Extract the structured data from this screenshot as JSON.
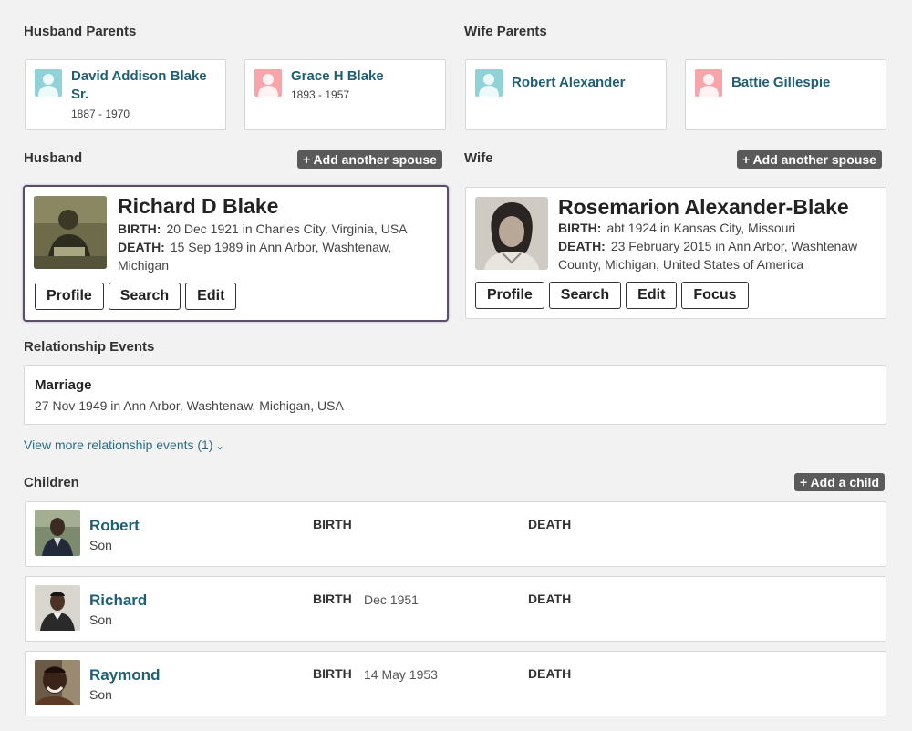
{
  "husband_parents": {
    "label": "Husband Parents",
    "father": {
      "name": "David Addison Blake Sr.",
      "dates": "1887 - 1970"
    },
    "mother": {
      "name": "Grace H Blake",
      "dates": "1893 - 1957"
    }
  },
  "wife_parents": {
    "label": "Wife Parents",
    "father": {
      "name": "Robert Alexander"
    },
    "mother": {
      "name": "Battie Gillespie"
    }
  },
  "husband": {
    "label": "Husband",
    "add_spouse": "+ Add another spouse",
    "name": "Richard D Blake",
    "birth_label": "BIRTH:",
    "birth": "20 Dec 1921 in Charles City, Virginia, USA",
    "death_label": "DEATH:",
    "death": "15 Sep 1989 in Ann Arbor, Washtenaw,",
    "death_cont": "Michigan",
    "buttons": {
      "profile": "Profile",
      "search": "Search",
      "edit": "Edit"
    }
  },
  "wife": {
    "label": "Wife",
    "add_spouse": "+ Add another spouse",
    "name": "Rosemarion Alexander-Blake",
    "birth_label": "BIRTH:",
    "birth": "abt 1924 in Kansas City, Missouri",
    "death_label": "DEATH:",
    "death": "23 February 2015 in Ann Arbor, Washtenaw",
    "death_cont": "County, Michigan, United States of America",
    "buttons": {
      "profile": "Profile",
      "search": "Search",
      "edit": "Edit",
      "focus": "Focus"
    }
  },
  "relationship": {
    "label": "Relationship Events",
    "event_title": "Marriage",
    "event_detail": "27 Nov 1949 in Ann Arbor, Washtenaw, Michigan, USA",
    "view_more": "View more relationship events (1)"
  },
  "children": {
    "label": "Children",
    "add_child": "+ Add a child",
    "birth_label": "BIRTH",
    "death_label": "DEATH",
    "items": [
      {
        "name": "Robert",
        "relation": "Son",
        "birth": "",
        "death": ""
      },
      {
        "name": "Richard",
        "relation": "Son",
        "birth": "Dec 1951",
        "death": ""
      },
      {
        "name": "Raymond",
        "relation": "Son",
        "birth": "14 May 1953",
        "death": ""
      }
    ]
  },
  "colors": {
    "link": "#1f5f73",
    "male_avatar": "#8fd3d8",
    "female_avatar": "#f7a5aa",
    "add_button": "#5a5a5a",
    "selected_border": "#5b4d6d"
  }
}
